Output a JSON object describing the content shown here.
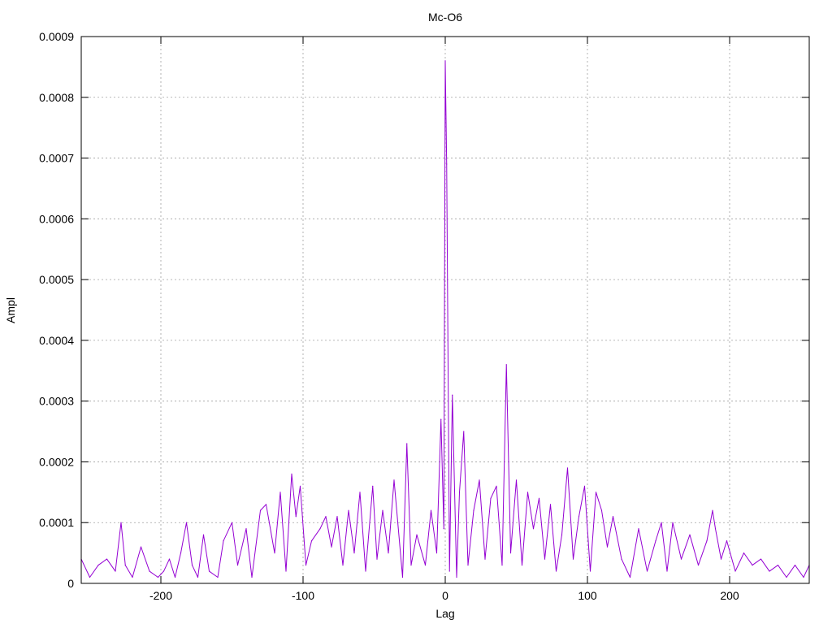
{
  "chart_data": {
    "type": "line",
    "title": "Mc-O6",
    "xlabel": "Lag",
    "ylabel": "Ampl",
    "xlim": [
      -256,
      256
    ],
    "ylim": [
      0,
      0.0009
    ],
    "xticks": [
      -200,
      -100,
      0,
      100,
      200
    ],
    "xtick_labels": [
      "-200",
      "-100",
      "0",
      "100",
      "200"
    ],
    "yticks": [
      0,
      0.0001,
      0.0002,
      0.0003,
      0.0004,
      0.0005,
      0.0006,
      0.0007,
      0.0008,
      0.0009
    ],
    "ytick_labels": [
      "0",
      "0.0001",
      "0.0002",
      "0.0003",
      "0.0004",
      "0.0005",
      "0.0006",
      "0.0007",
      "0.0008",
      "0.0009"
    ],
    "grid": true,
    "series": [
      {
        "color": "#9400d3",
        "x": [
          -256,
          -250,
          -244,
          -238,
          -232,
          -228,
          -225,
          -220,
          -214,
          -208,
          -202,
          -198,
          -194,
          -190,
          -186,
          -182,
          -178,
          -174,
          -170,
          -166,
          -160,
          -156,
          -150,
          -146,
          -140,
          -136,
          -130,
          -126,
          -120,
          -116,
          -112,
          -108,
          -105,
          -102,
          -98,
          -94,
          -88,
          -84,
          -80,
          -76,
          -72,
          -68,
          -64,
          -60,
          -56,
          -51,
          -48,
          -44,
          -40,
          -36,
          -30,
          -27,
          -24,
          -20,
          -14,
          -10,
          -6,
          -3,
          -1,
          0,
          1,
          3,
          5,
          8,
          10,
          13,
          16,
          20,
          24,
          28,
          32,
          36,
          40,
          43,
          46,
          50,
          54,
          58,
          62,
          66,
          70,
          74,
          78,
          82,
          86,
          90,
          94,
          98,
          102,
          106,
          110,
          114,
          118,
          124,
          130,
          136,
          142,
          148,
          152,
          156,
          160,
          166,
          172,
          178,
          184,
          188,
          190,
          194,
          198,
          204,
          210,
          216,
          222,
          228,
          234,
          240,
          246,
          252,
          256
        ],
        "y": [
          4e-05,
          1e-05,
          3e-05,
          4e-05,
          2e-05,
          0.0001,
          3e-05,
          1e-05,
          6e-05,
          2e-05,
          1e-05,
          2e-05,
          4e-05,
          1e-05,
          5e-05,
          0.0001,
          3e-05,
          1e-05,
          8e-05,
          2e-05,
          1e-05,
          7e-05,
          0.0001,
          3e-05,
          9e-05,
          1e-05,
          0.00012,
          0.00013,
          5e-05,
          0.00015,
          2e-05,
          0.00018,
          0.00011,
          0.00016,
          3e-05,
          7e-05,
          9e-05,
          0.00011,
          6e-05,
          0.00011,
          3e-05,
          0.00012,
          5e-05,
          0.00015,
          2e-05,
          0.00016,
          4e-05,
          0.00012,
          5e-05,
          0.00017,
          1e-05,
          0.00023,
          3e-05,
          8e-05,
          3e-05,
          0.00012,
          5e-05,
          0.00027,
          9e-05,
          0.00086,
          0.00069,
          2e-05,
          0.00031,
          1e-05,
          0.00015,
          0.00025,
          3e-05,
          0.00012,
          0.00017,
          4e-05,
          0.00014,
          0.00016,
          3e-05,
          0.00036,
          5e-05,
          0.00017,
          3e-05,
          0.00015,
          9e-05,
          0.00014,
          4e-05,
          0.00013,
          2e-05,
          8e-05,
          0.00019,
          4e-05,
          0.00011,
          0.00016,
          2e-05,
          0.00015,
          0.00012,
          6e-05,
          0.00011,
          4e-05,
          1e-05,
          9e-05,
          2e-05,
          7e-05,
          0.0001,
          2e-05,
          0.0001,
          4e-05,
          8e-05,
          3e-05,
          7e-05,
          0.00012,
          9e-05,
          4e-05,
          7e-05,
          2e-05,
          5e-05,
          3e-05,
          4e-05,
          2e-05,
          3e-05,
          1e-05,
          3e-05,
          1e-05,
          3e-05
        ]
      }
    ]
  }
}
